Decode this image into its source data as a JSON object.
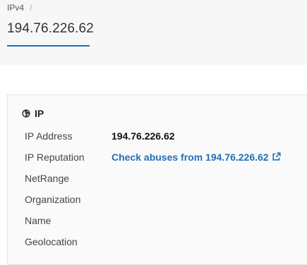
{
  "breadcrumb": {
    "item": "IPv4",
    "separator": "/"
  },
  "page": {
    "title": "194.76.226.62"
  },
  "ip_section": {
    "heading": "IP",
    "rows": [
      {
        "label": "IP Address",
        "value": "194.76.226.62"
      },
      {
        "label": "IP Reputation",
        "value": "Check abuses from 194.76.226.62"
      },
      {
        "label": "NetRange",
        "value": ""
      },
      {
        "label": "Organization",
        "value": ""
      },
      {
        "label": "Name",
        "value": ""
      },
      {
        "label": "Geolocation",
        "value": ""
      }
    ]
  },
  "colors": {
    "accent": "#1f6fb5",
    "link": "#1f6fb5"
  },
  "icons": {
    "heading_icon": "globe-icon",
    "reputation_link_icon": "external-link-icon"
  }
}
